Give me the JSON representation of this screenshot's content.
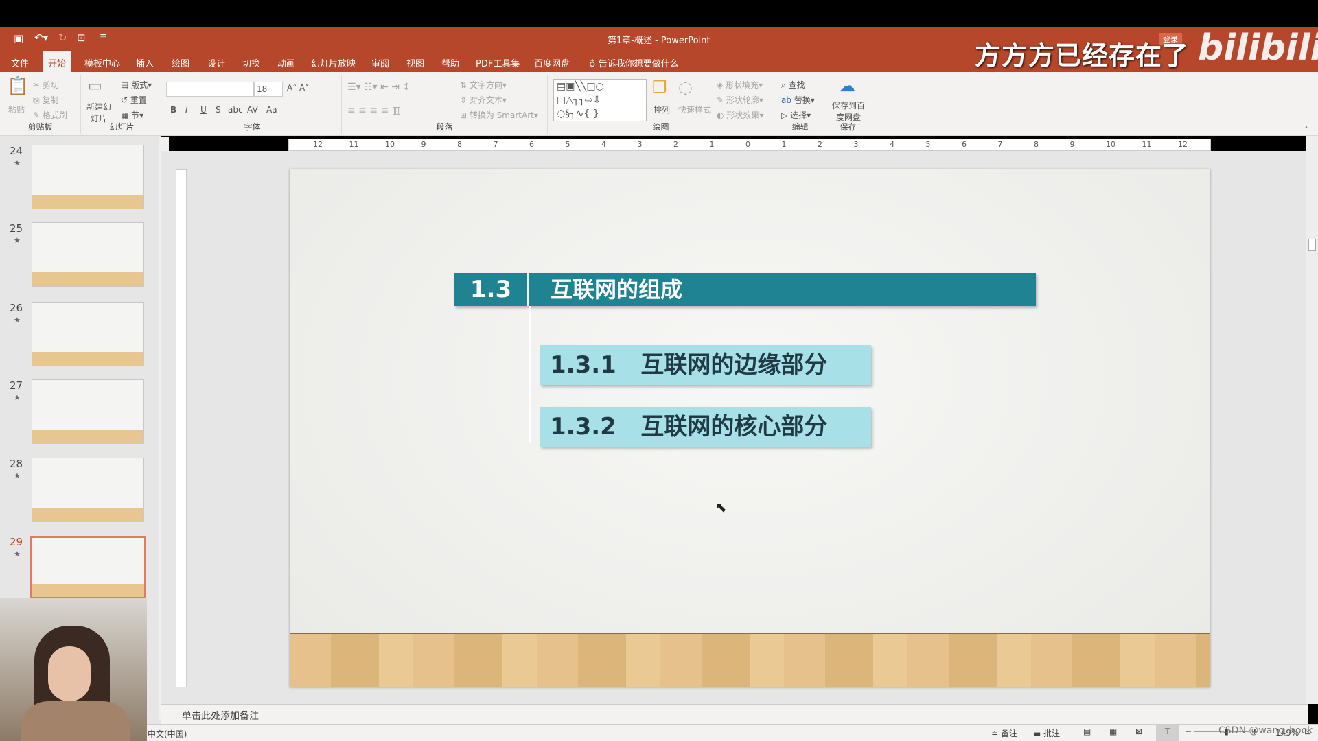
{
  "window": {
    "title": "第1章-概述 - PowerPoint"
  },
  "quick_access": {
    "icons": [
      "save-icon",
      "undo-icon",
      "redo-icon",
      "present-icon",
      "customize-icon"
    ]
  },
  "tabs": [
    "文件",
    "开始",
    "模板中心",
    "插入",
    "绘图",
    "设计",
    "切换",
    "动画",
    "幻灯片放映",
    "审阅",
    "视图",
    "帮助",
    "PDF工具集",
    "百度网盘"
  ],
  "active_tab": "开始",
  "tell_me": "告诉我你想要做什么",
  "ribbon": {
    "clipboard": {
      "label": "剪贴板",
      "paste": "粘贴",
      "cut": "剪切",
      "copy": "复制",
      "format_painter": "格式刷"
    },
    "slides": {
      "label": "幻灯片",
      "new_slide": "新建幻灯片",
      "layout": "版式",
      "reset": "重置",
      "section": "节"
    },
    "font": {
      "label": "字体",
      "font_name": "",
      "font_size": "18",
      "bold": "B",
      "italic": "I",
      "underline": "U",
      "shadow": "S",
      "strike": "abc",
      "spacing": "AV",
      "case": "Aa"
    },
    "paragraph": {
      "label": "段落",
      "text_direction": "文字方向",
      "align_text": "对齐文本",
      "smartart": "转换为 SmartArt"
    },
    "drawing": {
      "label": "绘图",
      "arrange": "排列",
      "quick_styles": "快速样式",
      "shape_fill": "形状填充",
      "shape_outline": "形状轮廓",
      "shape_effects": "形状效果"
    },
    "editing": {
      "label": "编辑",
      "find": "查找",
      "replace": "替换",
      "select": "选择"
    },
    "save": {
      "label": "保存",
      "save_baidu": "保存到百度网盘"
    }
  },
  "ruler": {
    "h_ticks": [
      "12",
      "11",
      "10",
      "9",
      "8",
      "7",
      "6",
      "5",
      "4",
      "3",
      "2",
      "1",
      "0",
      "1",
      "2",
      "3",
      "4",
      "5",
      "6",
      "7",
      "8",
      "9",
      "10",
      "11",
      "12"
    ]
  },
  "thumbnails": [
    {
      "num": "24",
      "selected": false
    },
    {
      "num": "25",
      "selected": false
    },
    {
      "num": "26",
      "selected": false
    },
    {
      "num": "27",
      "selected": false
    },
    {
      "num": "28",
      "selected": false
    },
    {
      "num": "29",
      "selected": true
    }
  ],
  "slide": {
    "header_num": "1.3",
    "header_title": "互联网的组成",
    "items": [
      "1.3.1   互联网的边缘部分",
      "1.3.2   互联网的核心部分"
    ],
    "colors": {
      "header": "#1f8392",
      "item": "#a8e0e7"
    }
  },
  "notes_placeholder": "单击此处添加备注",
  "status": {
    "language": "中文(中国)",
    "notes": "备注",
    "comments": "批注",
    "zoom": "149%"
  },
  "overlay": {
    "watermark": "方方方已经存在了",
    "logo": "bilibili",
    "csdn": "CSDN @wang_book",
    "login": "登录"
  },
  "accent": "#b7472a"
}
